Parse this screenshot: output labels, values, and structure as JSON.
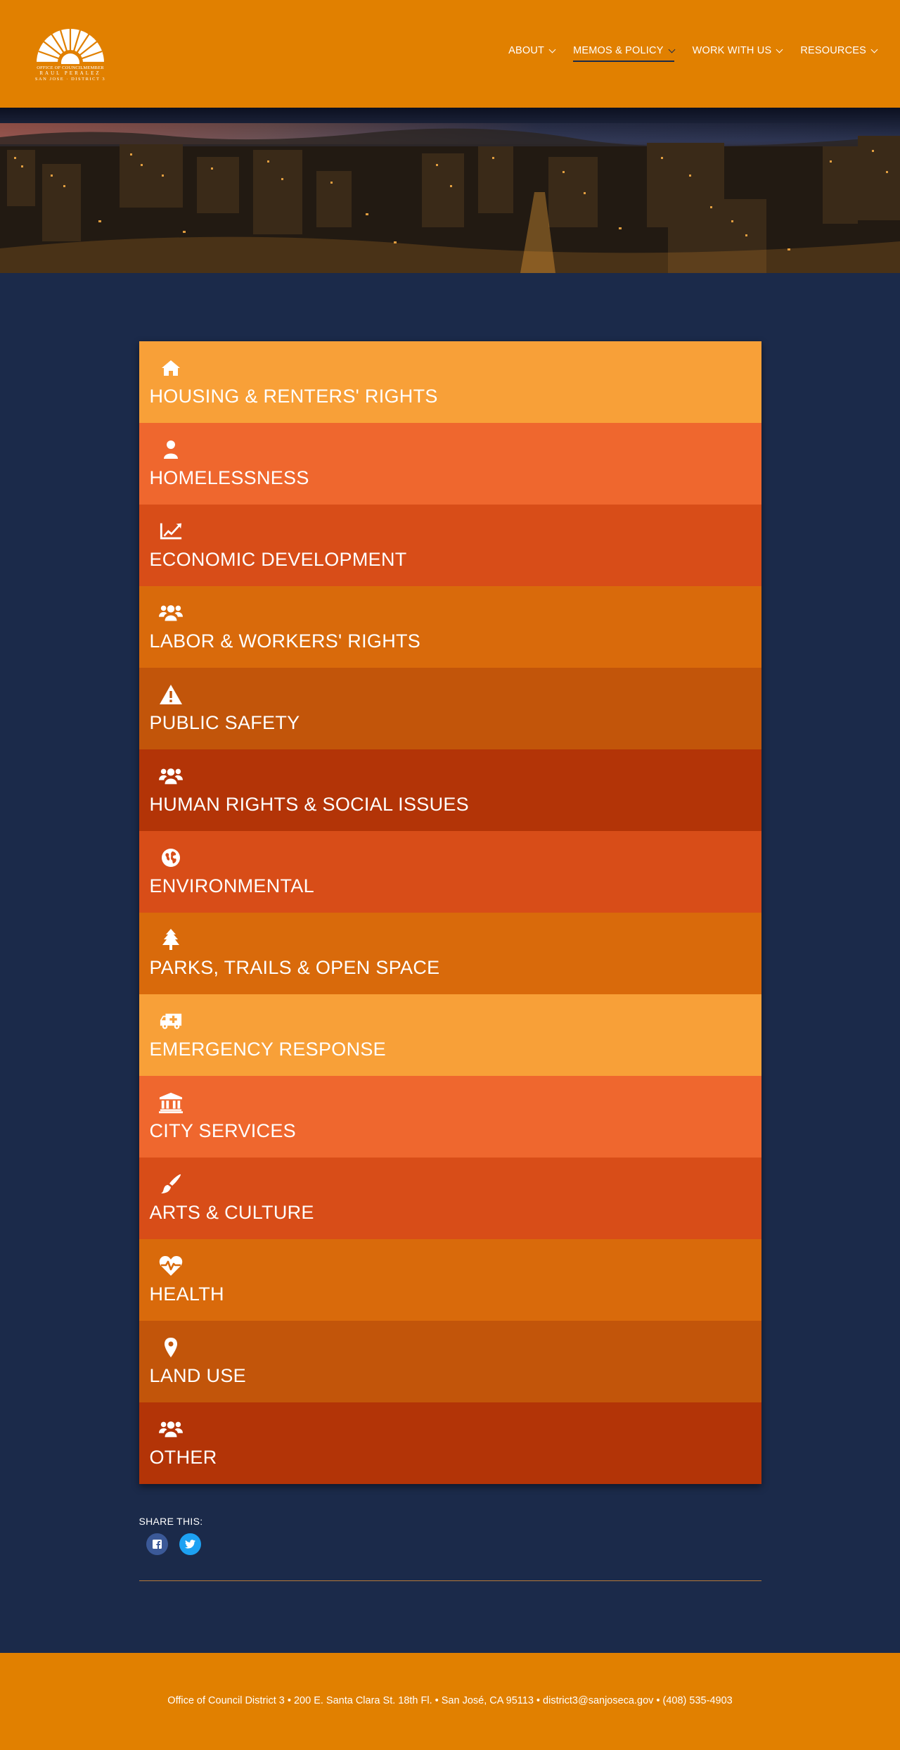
{
  "logo": {
    "line1": "OFFICE OF COUNCILMEMBER",
    "line2": "RAUL PERALEZ",
    "line3": "SAN JOSE · DISTRICT 3"
  },
  "nav": [
    {
      "label": "ABOUT"
    },
    {
      "label": "MEMOS & POLICY"
    },
    {
      "label": "WORK WITH US"
    },
    {
      "label": "RESOURCES"
    }
  ],
  "colors": {
    "header": "#e18000",
    "background": "#1b2a4a",
    "item_shades": [
      "#f8a038",
      "#ef672e",
      "#d84d18",
      "#d96a0b",
      "#c2550a",
      "#b33407"
    ]
  },
  "policy_items": [
    {
      "label": "HOUSING & RENTERS' RIGHTS",
      "icon": "home-icon"
    },
    {
      "label": "HOMELESSNESS",
      "icon": "user-icon"
    },
    {
      "label": "ECONOMIC DEVELOPMENT",
      "icon": "line-chart-icon"
    },
    {
      "label": "LABOR & WORKERS' RIGHTS",
      "icon": "users-icon"
    },
    {
      "label": "PUBLIC SAFETY",
      "icon": "warning-icon"
    },
    {
      "label": "HUMAN RIGHTS & SOCIAL ISSUES",
      "icon": "users-icon"
    },
    {
      "label": "ENVIRONMENTAL",
      "icon": "globe-icon"
    },
    {
      "label": "PARKS, TRAILS & OPEN SPACE",
      "icon": "tree-icon"
    },
    {
      "label": "EMERGENCY RESPONSE",
      "icon": "ambulance-icon"
    },
    {
      "label": "CITY SERVICES",
      "icon": "building-icon"
    },
    {
      "label": "ARTS & CULTURE",
      "icon": "paintbrush-icon"
    },
    {
      "label": "HEALTH",
      "icon": "heartbeat-icon"
    },
    {
      "label": "LAND USE",
      "icon": "map-marker-icon"
    },
    {
      "label": "OTHER",
      "icon": "users-icon"
    }
  ],
  "share": {
    "title": "SHARE THIS:",
    "facebook": "f",
    "twitter": "t"
  },
  "footer": {
    "text": "Office of Council District 3 • 200 E. Santa Clara St. 18th Fl. • San José, CA 95113 • district3@sanjoseca.gov • (408) 535-4903"
  }
}
